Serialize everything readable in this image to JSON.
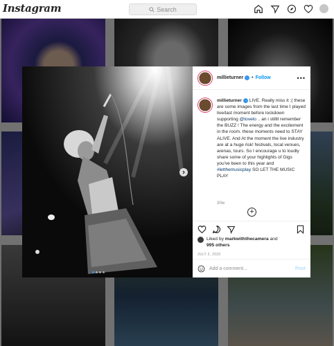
{
  "app": {
    "logo": "Instagram"
  },
  "search": {
    "placeholder": "Search",
    "icon": "search-icon"
  },
  "nav_icons": [
    "home-icon",
    "direct-icon",
    "explore-icon",
    "heart-icon",
    "profile-avatar"
  ],
  "post": {
    "username": "millieturner",
    "follow_label": "Follow",
    "follow_separator": "•",
    "more_label": "•••",
    "caption_parts": {
      "p1": " LIVE. Really miss it :( these are some images from the last time I played live/last moment before lockdown supporting ",
      "mention": "@tovelo",
      "p2": " .. an i stillll remember the BUZZ ! The energy and the excitement in the room. these moments need to STAY ALIVE. And At the moment the live industry are at a huge risk! festivals, local venues, arenas, tours. So I encourage u to loudly share some of your highlights of Gigs you've been to this year and ",
      "hashtag": "#letthemusicplay",
      "p3": " SO LET THE MUSIC PLAY"
    },
    "age": "30w",
    "likes": {
      "prefix": "Liked by ",
      "user": "markwiththecamera",
      "middle": " and",
      "count": "995 others"
    },
    "date": "JULY 2, 2020",
    "comment_placeholder": "Add a comment...",
    "post_label": "Post",
    "carousel": {
      "slides": 4,
      "active_index": 0
    }
  },
  "colors": {
    "accent": "#0095f6",
    "verified": "#3897f0",
    "text": "#262626",
    "muted": "#8e8e8e"
  }
}
